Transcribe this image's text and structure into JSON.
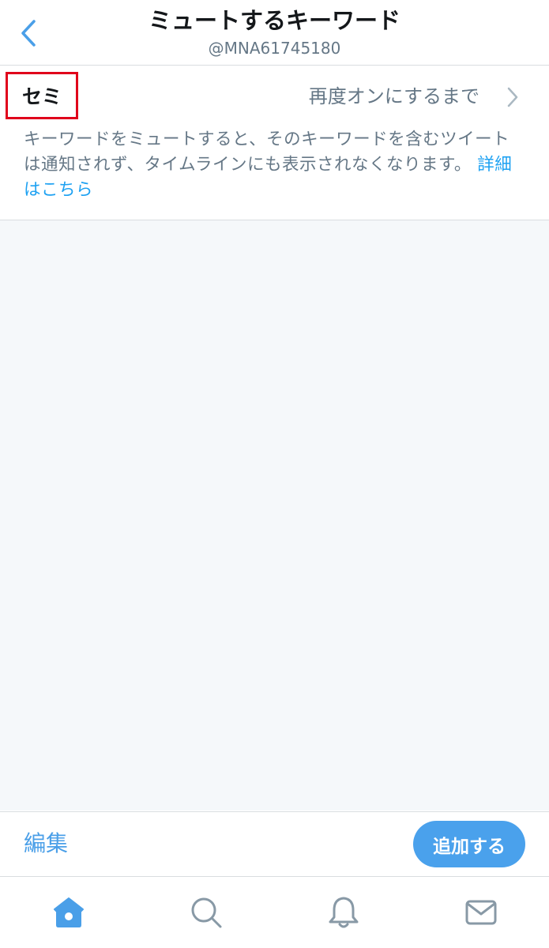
{
  "header": {
    "back_icon": "chevron-left-icon",
    "title": "ミュートするキーワード",
    "subtitle": "@MNA61745180"
  },
  "muted_keyword": {
    "keyword": "セミ",
    "duration": "再度オンにするまで",
    "chevron_icon": "chevron-right-icon"
  },
  "description": {
    "text": "キーワードをミュートすると、そのキーワードを含むツイートは通知されず、タイムラインにも表示されなくなります。 ",
    "link": "詳細はこちら"
  },
  "bottom_bar": {
    "edit_label": "編集",
    "add_label": "追加する"
  },
  "tab_bar": {
    "tabs": [
      {
        "icon": "home-icon",
        "active": true
      },
      {
        "icon": "search-icon",
        "active": false
      },
      {
        "icon": "bell-icon",
        "active": false
      },
      {
        "icon": "mail-icon",
        "active": false
      }
    ]
  },
  "colors": {
    "accent": "#1da1f2",
    "highlight_box": "#e0001b",
    "secondary_text": "#657786",
    "empty_background": "#f5f8fa"
  }
}
